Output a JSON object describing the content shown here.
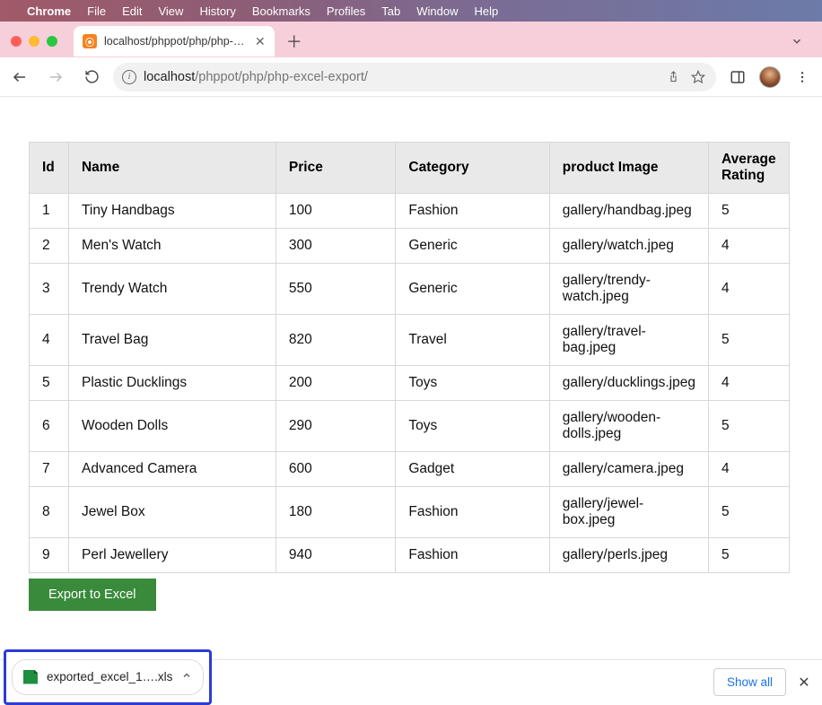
{
  "menubar": {
    "app": "Chrome",
    "items": [
      "File",
      "Edit",
      "View",
      "History",
      "Bookmarks",
      "Profiles",
      "Tab",
      "Window",
      "Help"
    ]
  },
  "browser": {
    "tab_title": "localhost/phppot/php/php-exc…",
    "url_host": "localhost",
    "url_path": "/phppot/php/php-excel-export/"
  },
  "table": {
    "headers": [
      "Id",
      "Name",
      "Price",
      "Category",
      "product Image",
      "Average Rating"
    ],
    "rows": [
      {
        "id": "1",
        "name": "Tiny Handbags",
        "price": "100",
        "category": "Fashion",
        "image": "gallery/handbag.jpeg",
        "rating": "5"
      },
      {
        "id": "2",
        "name": "Men's Watch",
        "price": "300",
        "category": "Generic",
        "image": "gallery/watch.jpeg",
        "rating": "4"
      },
      {
        "id": "3",
        "name": "Trendy Watch",
        "price": "550",
        "category": "Generic",
        "image": "gallery/trendy-watch.jpeg",
        "rating": "4"
      },
      {
        "id": "4",
        "name": "Travel Bag",
        "price": "820",
        "category": "Travel",
        "image": "gallery/travel-bag.jpeg",
        "rating": "5"
      },
      {
        "id": "5",
        "name": "Plastic Ducklings",
        "price": "200",
        "category": "Toys",
        "image": "gallery/ducklings.jpeg",
        "rating": "4"
      },
      {
        "id": "6",
        "name": "Wooden Dolls",
        "price": "290",
        "category": "Toys",
        "image": "gallery/wooden-dolls.jpeg",
        "rating": "5"
      },
      {
        "id": "7",
        "name": "Advanced Camera",
        "price": "600",
        "category": "Gadget",
        "image": "gallery/camera.jpeg",
        "rating": "4"
      },
      {
        "id": "8",
        "name": "Jewel Box",
        "price": "180",
        "category": "Fashion",
        "image": "gallery/jewel-box.jpeg",
        "rating": "5"
      },
      {
        "id": "9",
        "name": "Perl Jewellery",
        "price": "940",
        "category": "Fashion",
        "image": "gallery/perls.jpeg",
        "rating": "5"
      }
    ]
  },
  "buttons": {
    "export": "Export to Excel",
    "show_all": "Show all"
  },
  "download": {
    "filename": "exported_excel_1….xls"
  }
}
